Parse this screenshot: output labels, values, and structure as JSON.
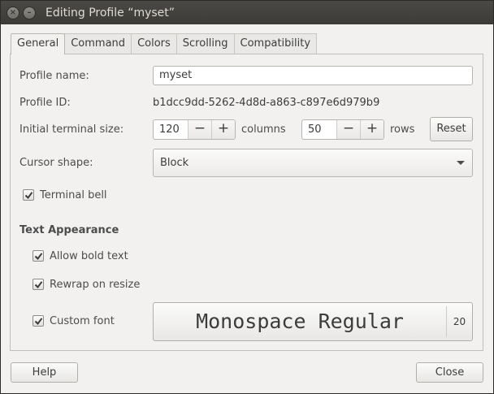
{
  "window": {
    "title": "Editing Profile “myset”"
  },
  "tabs": [
    "General",
    "Command",
    "Colors",
    "Scrolling",
    "Compatibility"
  ],
  "profile": {
    "name_label": "Profile name:",
    "name_value": "myset",
    "id_label": "Profile ID:",
    "id_value": "b1dcc9dd-5262-4d8d-a863-c897e6d979b9"
  },
  "size": {
    "label": "Initial terminal size:",
    "columns_value": "120",
    "columns_label": "columns",
    "rows_value": "50",
    "rows_label": "rows",
    "minus": "−",
    "plus": "+",
    "reset_label": "Reset"
  },
  "cursor": {
    "label": "Cursor shape:",
    "value": "Block"
  },
  "terminal_bell": {
    "label": "Terminal bell",
    "checked": true
  },
  "text_appearance": {
    "heading": "Text Appearance",
    "allow_bold": {
      "label": "Allow bold text",
      "checked": true
    },
    "rewrap": {
      "label": "Rewrap on resize",
      "checked": true
    },
    "custom_font": {
      "label": "Custom font",
      "checked": true
    },
    "font_name": "Monospace Regular",
    "font_size": "20"
  },
  "footer": {
    "help_label": "Help",
    "close_label": "Close"
  },
  "icons": {
    "close": "close-icon",
    "minimize": "minimize-icon",
    "dropdown": "chevron-down-icon",
    "check": "checkmark-icon"
  }
}
